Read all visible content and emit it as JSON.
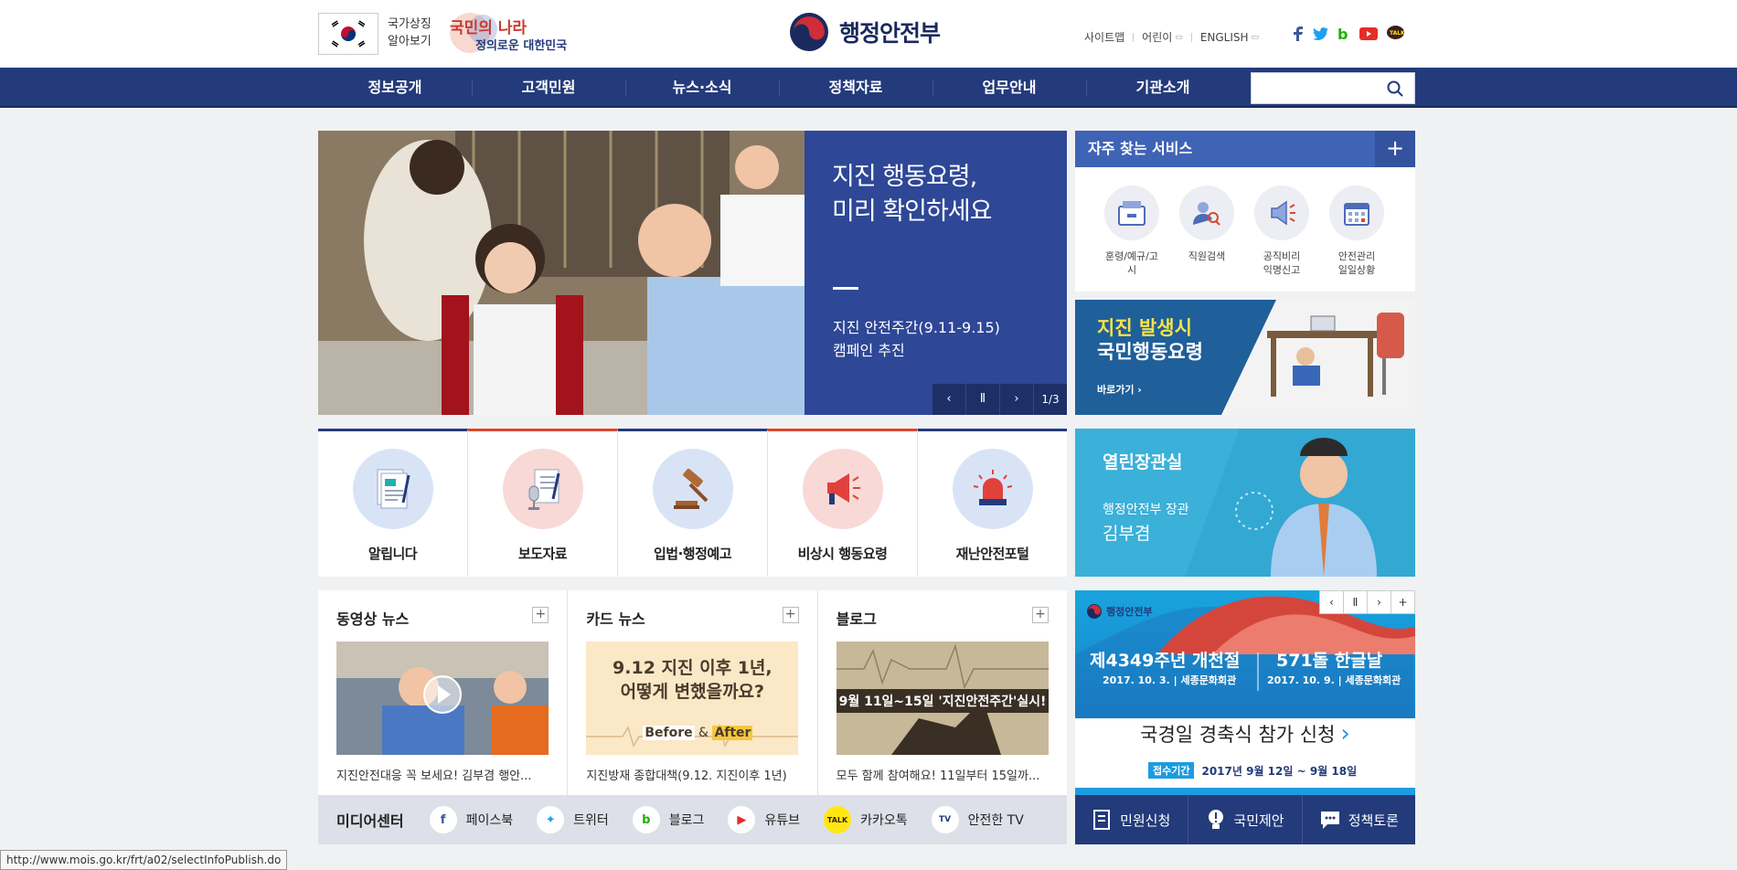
{
  "header": {
    "symbol_label_line1": "국가상징",
    "symbol_label_line2": "알아보기",
    "slogan_line1": "국민의 나라",
    "slogan_line2": "정의로운 대한민국",
    "logo_text": "행정안전부",
    "util_links": [
      "사이트맵",
      "어린이",
      "ENGLISH"
    ],
    "sns": [
      "facebook-icon",
      "twitter-icon",
      "blog-icon",
      "youtube-icon",
      "kakaotalk-icon"
    ],
    "colors": {
      "brand": "#233b7b",
      "accent_red": "#d9472b"
    }
  },
  "nav": {
    "items": [
      "정보공개",
      "고객민원",
      "뉴스·소식",
      "정책자료",
      "업무안내",
      "기관소개"
    ],
    "search_placeholder": ""
  },
  "hero": {
    "title_line1": "지진 행동요령,",
    "title_line2": "미리 확인하세요",
    "desc_line1": "지진 안전주간(9.11-9.15)",
    "desc_line2": "캠페인 추진",
    "prev": "‹",
    "pause": "Ⅱ",
    "next": "›",
    "counter": "1/3"
  },
  "quick_services": {
    "title": "자주 찾는 서비스",
    "plus": "+",
    "items": [
      {
        "line1": "훈령/예규/고시",
        "line2": ""
      },
      {
        "line1": "직원검색",
        "line2": ""
      },
      {
        "line1": "공직비리",
        "line2": "익명신고"
      },
      {
        "line1": "안전관리",
        "line2": "일일상황"
      }
    ]
  },
  "quake_banner": {
    "title_line1": "지진 발생시",
    "title_line2": "국민행동요령",
    "link": "바로가기 ›"
  },
  "icon_menu": [
    "알립니다",
    "보도자료",
    "입법·행정예고",
    "비상시 행동요령",
    "재난안전포털"
  ],
  "minister": {
    "title": "열린장관실",
    "role": "행정안전부 장관",
    "name": "김부겸"
  },
  "news": [
    {
      "title": "동영상 뉴스",
      "caption": "지진안전대응 꼭 보세요! 김부겸 행안..."
    },
    {
      "title": "카드 뉴스",
      "caption": "지진방재 종합대책(9.12. 지진이후 1년)",
      "thumb_line1": "9.12 지진 이후 1년,",
      "thumb_line2": "어떻게 변했을까요?",
      "thumb_before": "Before",
      "thumb_after": "After"
    },
    {
      "title": "블로그",
      "caption": "모두 함께 참여해요! 11일부터 15일까...",
      "thumb_text": "9월 11일~15일 '지진안전주간'실시!"
    }
  ],
  "media_center": {
    "title": "미디어센터",
    "items": [
      "페이스북",
      "트위터",
      "블로그",
      "유튜브",
      "카카오톡",
      "안전한 TV"
    ]
  },
  "event_banner": {
    "org": "행정안전부",
    "event1_title": "제4349주년 개천절",
    "event1_date": "2017. 10. 3.",
    "event1_place": "세종문화회관",
    "event2_title": "571돌 한글날",
    "event2_date": "2017. 10. 9.",
    "event2_place": "세종문화회관",
    "cta": "국경일 경축식 참가 신청",
    "period_label": "접수기간",
    "period_text": "2017년 9월 12일 ~ 9월 18일"
  },
  "civil": [
    "민원신청",
    "국민제안",
    "정책토론"
  ],
  "status_url": "http://www.mois.go.kr/frt/a02/selectInfoPublish.do"
}
